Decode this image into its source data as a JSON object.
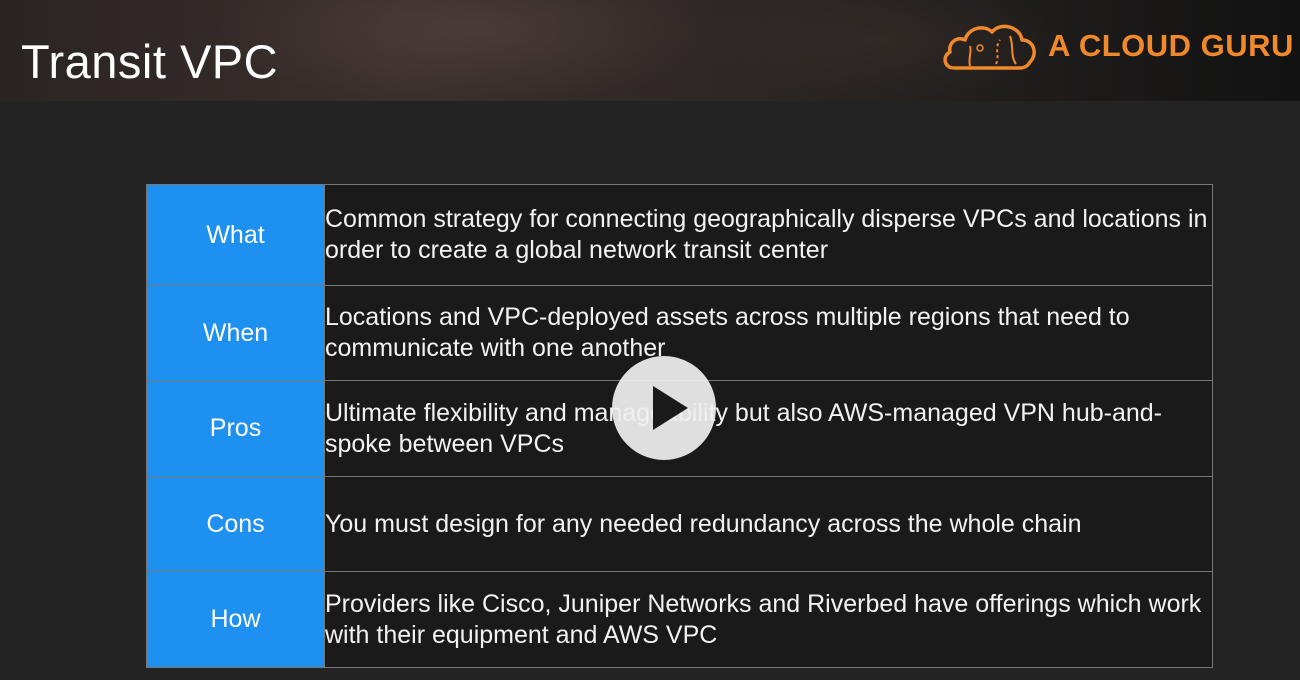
{
  "header": {
    "title": "Transit VPC",
    "logo_text": "A CLOUD GURU",
    "logo_icon": "cloud-logo-icon"
  },
  "table": {
    "rows": [
      {
        "label": "What",
        "text": "Common strategy for connecting geographically disperse VPCs and locations in order to create a global network transit center"
      },
      {
        "label": "When",
        "text": "Locations and VPC-deployed assets across multiple regions that need to communicate with one another"
      },
      {
        "label": "Pros",
        "text": "Ultimate flexibility and manageability but also AWS-managed VPN hub-and-spoke between VPCs"
      },
      {
        "label": "Cons",
        "text": "You must design for any needed redundancy across the whole chain"
      },
      {
        "label": "How",
        "text": "Providers like Cisco, Juniper Networks and Riverbed have offerings which work with their equipment and AWS VPC"
      }
    ]
  },
  "player": {
    "play_icon": "play-icon"
  },
  "colors": {
    "label_bg": "#1e90f0",
    "logo": "#f0892c",
    "background": "#232323"
  }
}
